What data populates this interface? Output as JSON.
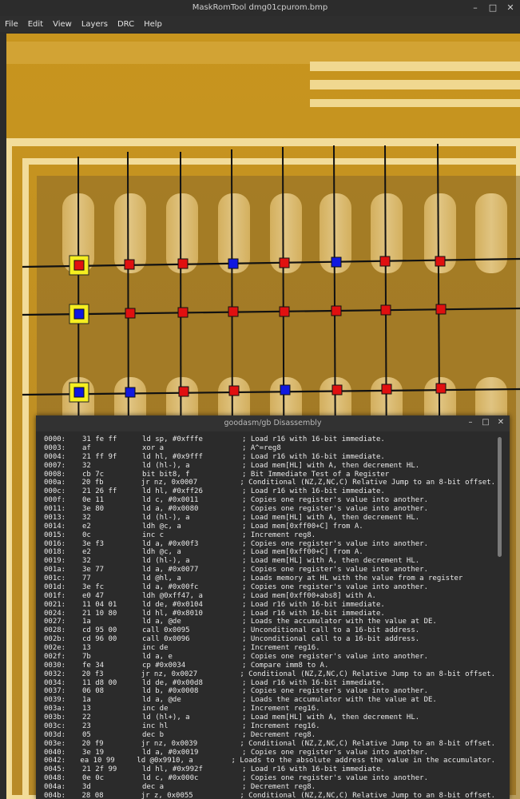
{
  "window": {
    "title": "MaskRomTool dmg01cpurom.bmp"
  },
  "window_controls": {
    "minimize": "–",
    "maximize": "□",
    "close": "✕"
  },
  "menu": [
    "File",
    "Edit",
    "View",
    "Layers",
    "DRC",
    "Help"
  ],
  "bit_colors": {
    "one": "#e01010",
    "zero": "#1018e0",
    "selected": "#f5ee20"
  },
  "disassembly": {
    "title": "goodasm/gb Disassembly",
    "controls": {
      "minimize": "–",
      "maximize": "□",
      "close": "✕"
    },
    "lines": [
      {
        "addr": "0000:",
        "bytes": "31 fe ff",
        "mn": "ld sp, #0xfffe",
        "cm": "; Load r16 with 16-bit immediate."
      },
      {
        "addr": "0003:",
        "bytes": "af",
        "mn": "xor a",
        "cm": "; A^=reg8"
      },
      {
        "addr": "0004:",
        "bytes": "21 ff 9f",
        "mn": "ld hl, #0x9fff",
        "cm": "; Load r16 with 16-bit immediate."
      },
      {
        "addr": "0007:",
        "bytes": "32",
        "mn": "ld (hl-), a",
        "cm": "; Load mem[HL] with A, then decrement HL."
      },
      {
        "addr": "0008:",
        "bytes": "cb 7c",
        "mn": "bit bit8, f",
        "cm": "; Bit Immediate Test of a Register"
      },
      {
        "addr": "000a:",
        "bytes": "20 fb",
        "mn": "jr nz, 0x0007",
        "cm": "; Conditional (NZ,Z,NC,C) Relative Jump to an 8-bit offset."
      },
      {
        "addr": "000c:",
        "bytes": "21 26 ff",
        "mn": "ld hl, #0xff26",
        "cm": "; Load r16 with 16-bit immediate."
      },
      {
        "addr": "000f:",
        "bytes": "0e 11",
        "mn": "ld c, #0x0011",
        "cm": "; Copies one register's value into another."
      },
      {
        "addr": "0011:",
        "bytes": "3e 80",
        "mn": "ld a, #0x0080",
        "cm": "; Copies one register's value into another."
      },
      {
        "addr": "0013:",
        "bytes": "32",
        "mn": "ld (hl-), a",
        "cm": "; Load mem[HL] with A, then decrement HL."
      },
      {
        "addr": "0014:",
        "bytes": "e2",
        "mn": "ldh @c, a",
        "cm": "; Load mem[0xff00+C] from A."
      },
      {
        "addr": "0015:",
        "bytes": "0c",
        "mn": "inc c",
        "cm": "; Increment reg8."
      },
      {
        "addr": "0016:",
        "bytes": "3e f3",
        "mn": "ld a, #0x00f3",
        "cm": "; Copies one register's value into another."
      },
      {
        "addr": "0018:",
        "bytes": "e2",
        "mn": "ldh @c, a",
        "cm": "; Load mem[0xff00+C] from A."
      },
      {
        "addr": "0019:",
        "bytes": "32",
        "mn": "ld (hl-), a",
        "cm": "; Load mem[HL] with A, then decrement HL."
      },
      {
        "addr": "001a:",
        "bytes": "3e 77",
        "mn": "ld a, #0x0077",
        "cm": "; Copies one register's value into another."
      },
      {
        "addr": "001c:",
        "bytes": "77",
        "mn": "ld @hl, a",
        "cm": "; Loads memory at HL with the value from a register"
      },
      {
        "addr": "001d:",
        "bytes": "3e fc",
        "mn": "ld a, #0x00fc",
        "cm": "; Copies one register's value into another."
      },
      {
        "addr": "001f:",
        "bytes": "e0 47",
        "mn": "ldh @0xff47, a",
        "cm": "; Load mem[0xff00+abs8] with A."
      },
      {
        "addr": "0021:",
        "bytes": "11 04 01",
        "mn": "ld de, #0x0104",
        "cm": "; Load r16 with 16-bit immediate."
      },
      {
        "addr": "0024:",
        "bytes": "21 10 80",
        "mn": "ld hl, #0x8010",
        "cm": "; Load r16 with 16-bit immediate."
      },
      {
        "addr": "0027:",
        "bytes": "1a",
        "mn": "ld a, @de",
        "cm": "; Loads the accumulator with the value at DE."
      },
      {
        "addr": "0028:",
        "bytes": "cd 95 00",
        "mn": "call 0x0095",
        "cm": "; Unconditional call to a 16-bit address."
      },
      {
        "addr": "002b:",
        "bytes": "cd 96 00",
        "mn": "call 0x0096",
        "cm": "; Unconditional call to a 16-bit address."
      },
      {
        "addr": "002e:",
        "bytes": "13",
        "mn": "inc de",
        "cm": "; Increment reg16."
      },
      {
        "addr": "002f:",
        "bytes": "7b",
        "mn": "ld a, e",
        "cm": "; Copies one register's value into another."
      },
      {
        "addr": "0030:",
        "bytes": "fe 34",
        "mn": "cp #0x0034",
        "cm": "; Compare imm8 to A."
      },
      {
        "addr": "0032:",
        "bytes": "20 f3",
        "mn": "jr nz, 0x0027",
        "cm": "; Conditional (NZ,Z,NC,C) Relative Jump to an 8-bit offset."
      },
      {
        "addr": "0034:",
        "bytes": "11 d8 00",
        "mn": "ld de, #0x00d8",
        "cm": "; Load r16 with 16-bit immediate."
      },
      {
        "addr": "0037:",
        "bytes": "06 08",
        "mn": "ld b, #0x0008",
        "cm": "; Copies one register's value into another."
      },
      {
        "addr": "0039:",
        "bytes": "1a",
        "mn": "ld a, @de",
        "cm": "; Loads the accumulator with the value at DE."
      },
      {
        "addr": "003a:",
        "bytes": "13",
        "mn": "inc de",
        "cm": "; Increment reg16."
      },
      {
        "addr": "003b:",
        "bytes": "22",
        "mn": "ld (hl+), a",
        "cm": "; Load mem[HL] with A, then decrement HL."
      },
      {
        "addr": "003c:",
        "bytes": "23",
        "mn": "inc hl",
        "cm": "; Increment reg16."
      },
      {
        "addr": "003d:",
        "bytes": "05",
        "mn": "dec b",
        "cm": "; Decrement reg8."
      },
      {
        "addr": "003e:",
        "bytes": "20 f9",
        "mn": "jr nz, 0x0039",
        "cm": "; Conditional (NZ,Z,NC,C) Relative Jump to an 8-bit offset."
      },
      {
        "addr": "0040:",
        "bytes": "3e 19",
        "mn": "ld a, #0x0019",
        "cm": "; Copies one register's value into another."
      },
      {
        "addr": "0042:",
        "bytes": "ea 10 99",
        "mn": "ld @0x9910, a",
        "cm": "; Loads to the absolute address the value in the accumulator."
      },
      {
        "addr": "0045:",
        "bytes": "21 2f 99",
        "mn": "ld hl, #0x992f",
        "cm": "; Load r16 with 16-bit immediate."
      },
      {
        "addr": "0048:",
        "bytes": "0e 0c",
        "mn": "ld c, #0x000c",
        "cm": "; Copies one register's value into another."
      },
      {
        "addr": "004a:",
        "bytes": "3d",
        "mn": "dec a",
        "cm": "; Decrement reg8."
      },
      {
        "addr": "004b:",
        "bytes": "28 08",
        "mn": "jr z, 0x0055",
        "cm": "; Conditional (NZ,Z,NC,C) Relative Jump to an 8-bit offset."
      }
    ]
  }
}
